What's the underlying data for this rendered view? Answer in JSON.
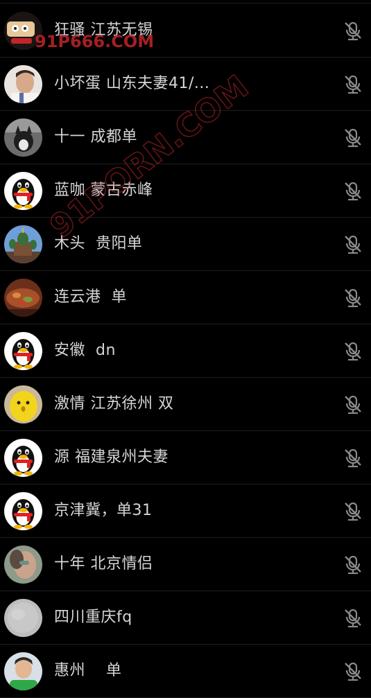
{
  "contacts": [
    {
      "name": "狂骚 江苏无锡",
      "avatar": "cartoon-logo-avatar",
      "muted": true
    },
    {
      "name": "小坏蛋 山东夫妻41/...",
      "avatar": "man-photo-avatar",
      "muted": true
    },
    {
      "name": "十一 成都单",
      "avatar": "cat-photo-avatar",
      "muted": true
    },
    {
      "name": "蓝咖 蒙古赤峰",
      "avatar": "qq-penguin-avatar",
      "muted": true
    },
    {
      "name": "木头  贵阳单",
      "avatar": "church-photo-avatar",
      "muted": true
    },
    {
      "name": "连云港  单",
      "avatar": "food-photo-avatar",
      "muted": true
    },
    {
      "name": "安徽  dn",
      "avatar": "qq-penguin-avatar",
      "muted": true
    },
    {
      "name": "激情 江苏徐州 双",
      "avatar": "yellow-toy-avatar",
      "muted": true
    },
    {
      "name": "源 福建泉州夫妻",
      "avatar": "qq-penguin-avatar",
      "muted": true
    },
    {
      "name": "京津冀，单31",
      "avatar": "qq-penguin-avatar",
      "muted": true
    },
    {
      "name": "十年 北京情侣",
      "avatar": "face-photo-avatar",
      "muted": true
    },
    {
      "name": "四川重庆fq",
      "avatar": "gray-blank-avatar",
      "muted": true
    },
    {
      "name": "惠州    单",
      "avatar": "man-green-shirt-avatar",
      "muted": true
    }
  ],
  "watermarks": {
    "top": "91P666.COM",
    "diagonal": "91PORN.COM"
  },
  "colors": {
    "background": "#000000",
    "text": "#d6d6d6",
    "divider": "#1e1e1e",
    "icon": "#8a8a8a",
    "watermark": "#c0262a"
  }
}
